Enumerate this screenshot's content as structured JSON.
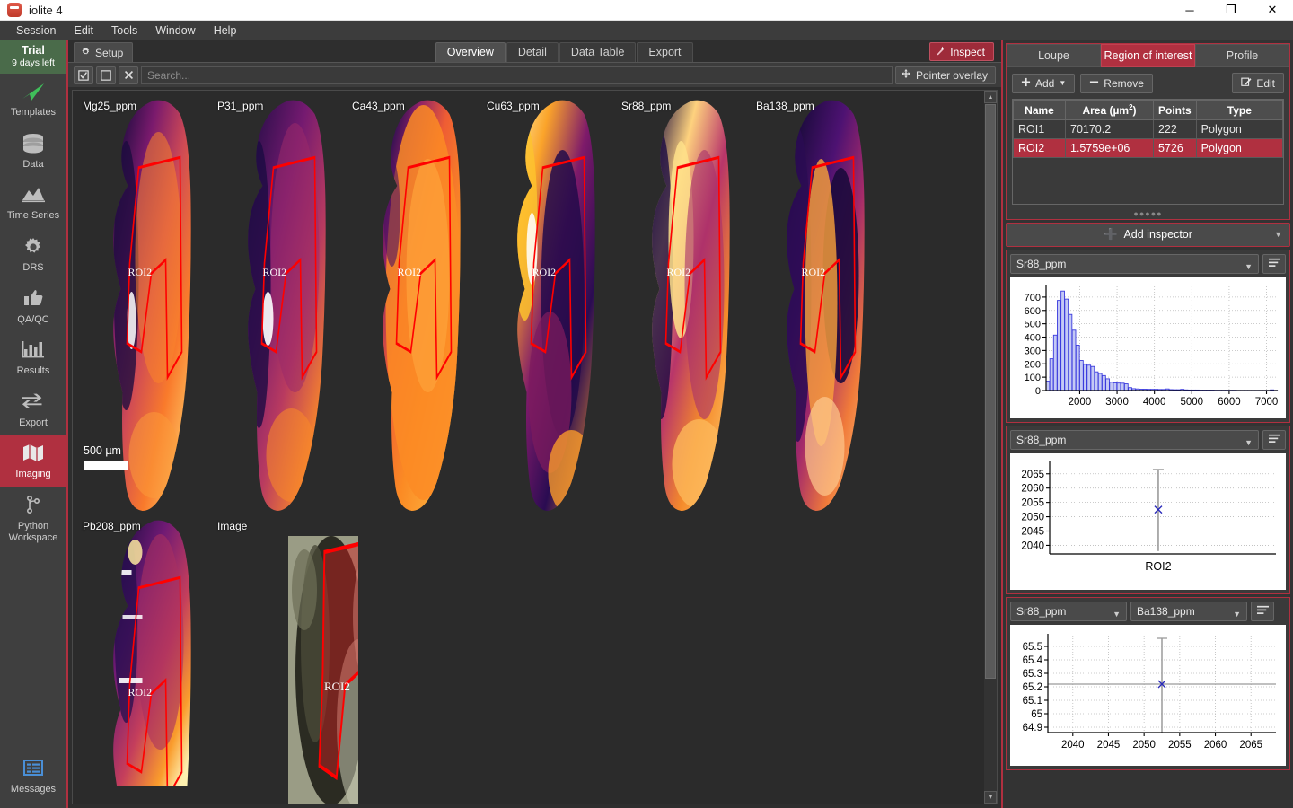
{
  "window": {
    "title": "iolite 4",
    "minimize": "─",
    "maximize": "❐",
    "close": "✕"
  },
  "menubar": [
    {
      "label": "Session"
    },
    {
      "label": "Edit"
    },
    {
      "label": "Tools"
    },
    {
      "label": "Window"
    },
    {
      "label": "Help"
    }
  ],
  "sidebar": {
    "trial": {
      "title": "Trial",
      "subtitle": "9 days left"
    },
    "items": [
      {
        "label": "Templates",
        "icon": "paper-plane-icon",
        "active": false
      },
      {
        "label": "Data",
        "icon": "database-icon",
        "active": false
      },
      {
        "label": "Time Series",
        "icon": "mountain-chart-icon",
        "active": false
      },
      {
        "label": "DRS",
        "icon": "gear-icon",
        "active": false
      },
      {
        "label": "QA/QC",
        "icon": "thumbs-up-icon",
        "active": false
      },
      {
        "label": "Results",
        "icon": "bar-chart-icon",
        "active": false
      },
      {
        "label": "Export",
        "icon": "arrows-exchange-icon",
        "active": false
      },
      {
        "label": "Imaging",
        "icon": "map-icon",
        "active": true
      },
      {
        "label": "Python Workspace",
        "icon": "branch-icon",
        "active": false
      }
    ],
    "bottom": {
      "label": "Messages",
      "icon": "messages-icon"
    }
  },
  "center": {
    "setup_label": "Setup",
    "tabs": [
      {
        "label": "Overview",
        "active": true
      },
      {
        "label": "Detail",
        "active": false
      },
      {
        "label": "Data Table",
        "active": false
      },
      {
        "label": "Export",
        "active": false
      }
    ],
    "inspect_label": "Inspect",
    "toolbar": {
      "check_all_icon": "checked-box-icon",
      "uncheck_all_icon": "empty-box-icon",
      "clear_icon": "cross-icon",
      "search_placeholder": "Search...",
      "search_value": "",
      "pointer_overlay_label": "Pointer overlay",
      "pointer_overlay_icon": "move-crosshair-icon"
    },
    "scalebar": {
      "label": "500 µm"
    },
    "roi_label": "ROI2",
    "panels": [
      {
        "label": "Mg25_ppm",
        "kind": "element-map"
      },
      {
        "label": "P31_ppm",
        "kind": "element-map"
      },
      {
        "label": "Ca43_ppm",
        "kind": "element-map"
      },
      {
        "label": "Cu63_ppm",
        "kind": "element-map"
      },
      {
        "label": "Sr88_ppm",
        "kind": "element-map"
      },
      {
        "label": "Ba138_ppm",
        "kind": "element-map"
      },
      {
        "label": "Pb208_ppm",
        "kind": "element-map"
      },
      {
        "label": "Image",
        "kind": "optical-image"
      }
    ]
  },
  "right": {
    "tabs": [
      {
        "label": "Loupe",
        "active": false
      },
      {
        "label": "Region of interest",
        "active": true
      },
      {
        "label": "Profile",
        "active": false
      }
    ],
    "buttons": {
      "add": "Add",
      "remove": "Remove",
      "edit": "Edit"
    },
    "table": {
      "headers": [
        "Name",
        "Area (µm²)",
        "Points",
        "Type"
      ],
      "rows": [
        {
          "name": "ROI1",
          "area": "70170.2",
          "points": "222",
          "type": "Polygon",
          "selected": false
        },
        {
          "name": "ROI2",
          "area": "1.5759e+06",
          "points": "5726",
          "type": "Polygon",
          "selected": true
        }
      ]
    },
    "add_inspector_label": "Add inspector",
    "inspectors": [
      {
        "selector_x": "Sr88_ppm",
        "selector_y": null,
        "menu_icon": "hamburger-lines-icon"
      },
      {
        "selector_x": "Sr88_ppm",
        "selector_y": null,
        "menu_icon": "hamburger-lines-icon"
      },
      {
        "selector_x": "Sr88_ppm",
        "selector_y": "Ba138_ppm",
        "menu_icon": "hamburger-lines-icon"
      }
    ]
  },
  "colors": {
    "accent": "#b03040",
    "sidebar_bg": "#3f3f3f",
    "panel_bg": "#333333",
    "canvas_bg": "#2b2b2b",
    "trial_green": "#4a6b4a",
    "roi_outline": "#ff0000",
    "plot_series": "#3b3bdd"
  },
  "chart_data": [
    {
      "type": "bar",
      "title": "",
      "xlabel": "",
      "ylabel": "",
      "variable": "Sr88_ppm",
      "xlim": [
        1100,
        7300
      ],
      "ylim": [
        0,
        780
      ],
      "xticks": [
        2000,
        3000,
        4000,
        5000,
        6000,
        7000
      ],
      "yticks": [
        0,
        100,
        200,
        300,
        400,
        500,
        600,
        700
      ],
      "grid": true,
      "legend": "none",
      "bin_centers": [
        1150,
        1250,
        1350,
        1450,
        1550,
        1650,
        1750,
        1850,
        1950,
        2050,
        2150,
        2250,
        2350,
        2450,
        2550,
        2650,
        2750,
        2850,
        2950,
        3050,
        3150,
        3250,
        3350,
        3450,
        3550,
        3650,
        3750,
        3850,
        3950,
        4050,
        4150,
        4250,
        4350,
        4450,
        4550,
        4650,
        4750,
        4850,
        4950,
        5050,
        5150,
        5250,
        5350,
        5450,
        5550,
        5650,
        5750,
        5850,
        5950,
        6050,
        6150,
        6250,
        6350,
        6450,
        6550,
        6650,
        6750,
        6850,
        6950,
        7050,
        7150,
        7250
      ],
      "values": [
        70,
        238,
        415,
        675,
        745,
        685,
        570,
        452,
        340,
        225,
        196,
        190,
        180,
        140,
        128,
        112,
        88,
        62,
        58,
        56,
        55,
        50,
        22,
        14,
        12,
        10,
        10,
        9,
        9,
        9,
        8,
        8,
        12,
        7,
        6,
        6,
        9,
        5,
        4,
        4,
        4,
        3,
        3,
        3,
        3,
        2,
        2,
        2,
        2,
        2,
        2,
        1,
        1,
        1,
        1,
        1,
        1,
        1,
        1,
        1,
        5,
        1
      ]
    },
    {
      "type": "scatter",
      "title": "",
      "variable": "Sr88_ppm",
      "xlabel": "",
      "ylabel": "",
      "categories": [
        "ROI2"
      ],
      "yticks": [
        2040,
        2045,
        2050,
        2055,
        2060,
        2065
      ],
      "ylim": [
        2037,
        2069
      ],
      "grid": true,
      "legend": "none",
      "points": [
        {
          "category": "ROI2",
          "value": 2052.5,
          "err_low": 2038.0,
          "err_high": 2066.5
        }
      ]
    },
    {
      "type": "scatter",
      "title": "",
      "xlabel": "Sr88_ppm",
      "ylabel": "Ba138_ppm",
      "xticks": [
        2040,
        2045,
        2050,
        2055,
        2060,
        2065
      ],
      "yticks": [
        64.9,
        65,
        65.1,
        65.2,
        65.3,
        65.4,
        65.5
      ],
      "xlim": [
        2036.5,
        2068.5
      ],
      "ylim": [
        64.86,
        65.58
      ],
      "grid": true,
      "legend": "none",
      "points": [
        {
          "x": 2052.5,
          "y": 65.22,
          "xerr_low": 2036.5,
          "xerr_high": 2068.5,
          "yerr_low": 64.86,
          "yerr_high": 65.56
        }
      ]
    }
  ]
}
